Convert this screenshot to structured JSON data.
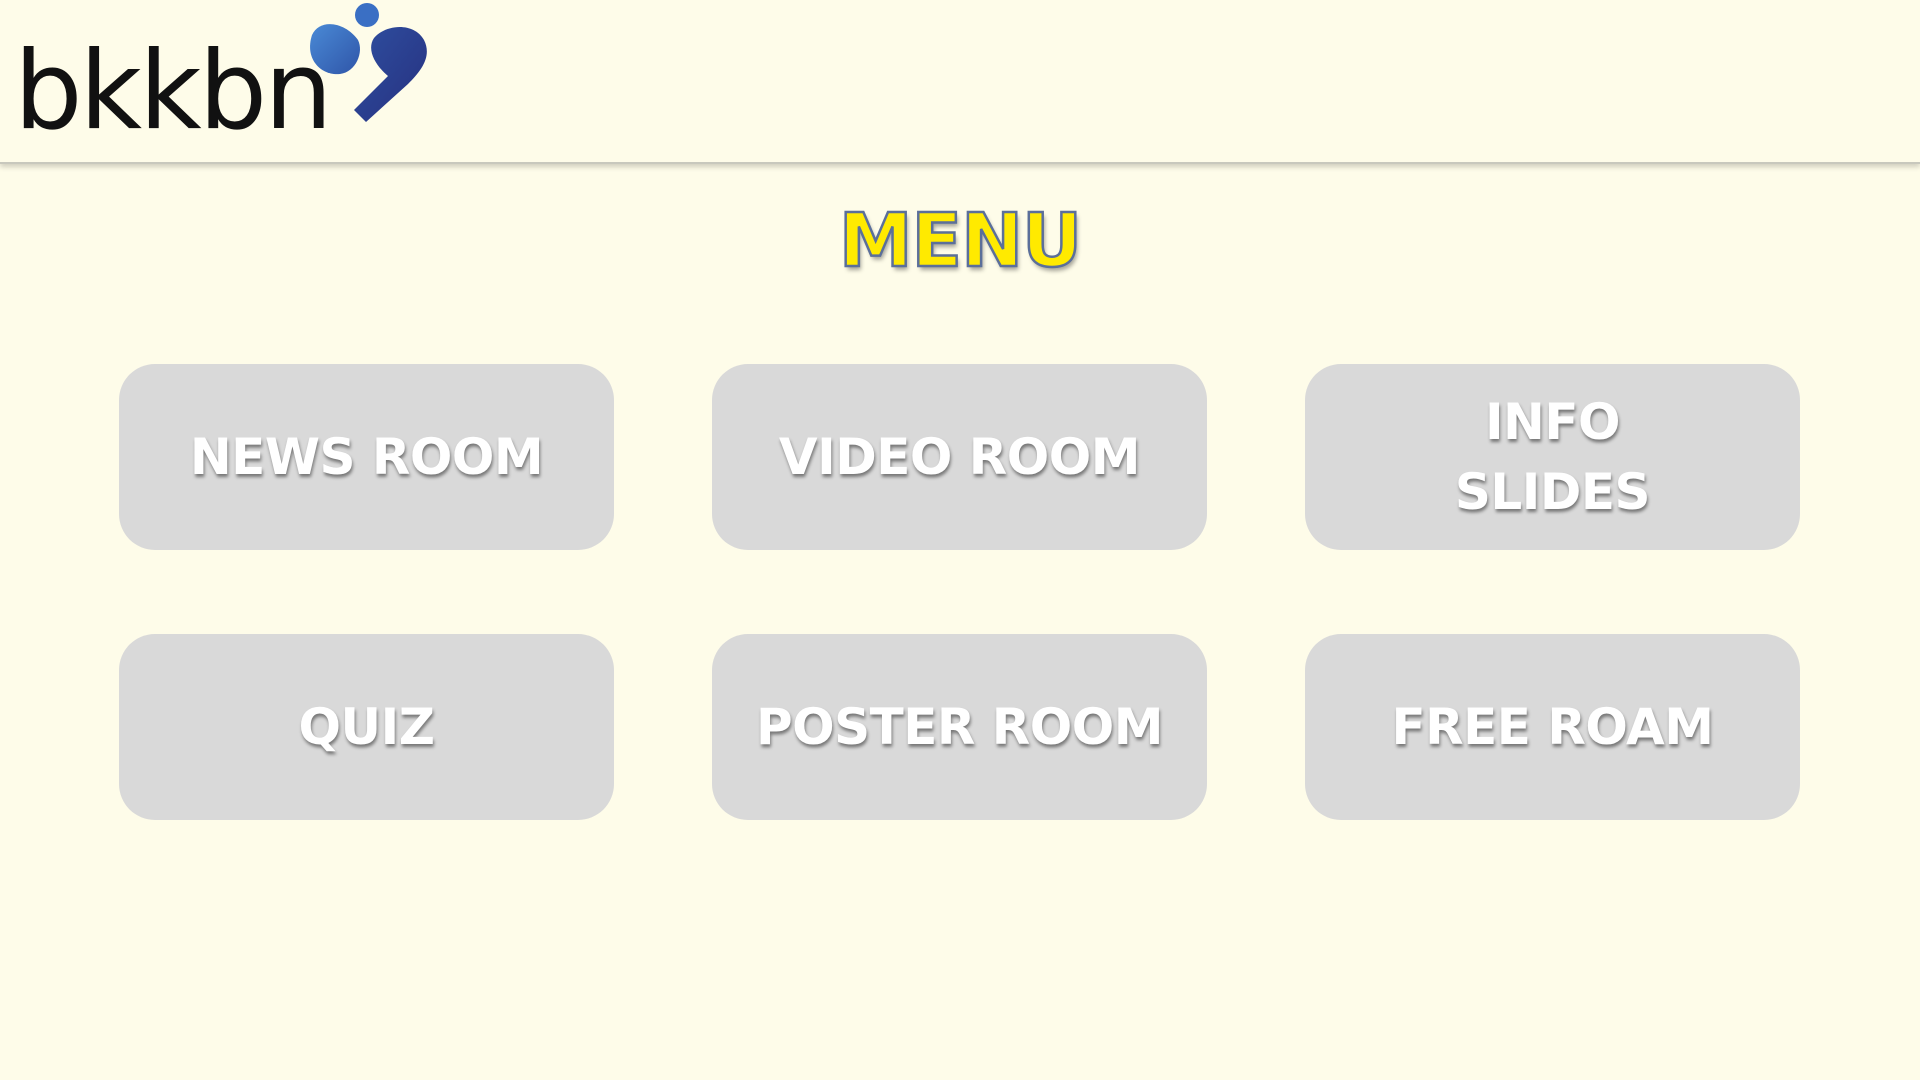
{
  "header": {
    "logo_text": "bkkbn",
    "colors": {
      "logo_blue_light": "#3f7fcf",
      "logo_blue_dark": "#27388a"
    }
  },
  "main": {
    "title": "MENU",
    "buttons": [
      {
        "label": "NEWS ROOM"
      },
      {
        "label": "VIDEO ROOM"
      },
      {
        "label": "INFO\nSLIDES"
      },
      {
        "label": "QUIZ"
      },
      {
        "label": "POSTER ROOM"
      },
      {
        "label": "FREE ROAM"
      }
    ]
  },
  "theme": {
    "background": "#fefce9",
    "button_fill": "#d9d9d9",
    "title_color": "#ffea00"
  }
}
